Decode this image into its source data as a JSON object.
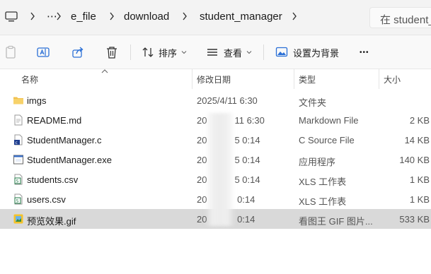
{
  "address_bar": {
    "crumbs": [
      "e_file",
      "download",
      "student_manager"
    ],
    "overflow_glyph": "⋯",
    "search_placeholder": "在 student_m"
  },
  "toolbar": {
    "sort_label": "排序",
    "view_label": "查看",
    "set_background_label": "设置为背景",
    "more_label": "•••"
  },
  "columns": {
    "name": "名称",
    "date": "修改日期",
    "type": "类型",
    "size": "大小"
  },
  "files": [
    {
      "icon": "folder-icon",
      "name": "imgs",
      "date": "2025/4/11 6:30",
      "type": "文件夹",
      "size": "",
      "selected": false
    },
    {
      "icon": "text-file-icon",
      "name": "README.md",
      "date": "20   11 6:30",
      "type": "Markdown File",
      "size": "2 KB",
      "selected": false
    },
    {
      "icon": "c-source-icon",
      "name": "StudentManager.c",
      "date": "20   5 0:14",
      "type": "C Source File",
      "size": "14 KB",
      "selected": false
    },
    {
      "icon": "exe-icon",
      "name": "StudentManager.exe",
      "date": "20   5 0:14",
      "type": "应用程序",
      "size": "140 KB",
      "selected": false
    },
    {
      "icon": "csv-icon",
      "name": "students.csv",
      "date": "20   5 0:14",
      "type": "XLS 工作表",
      "size": "1 KB",
      "selected": false
    },
    {
      "icon": "csv-icon",
      "name": "users.csv",
      "date": "20    0:14",
      "type": "XLS 工作表",
      "size": "1 KB",
      "selected": false
    },
    {
      "icon": "gif-icon",
      "name": "预览效果.gif",
      "date": "20    0:14",
      "type": "看图王 GIF 图片...",
      "size": "533 KB",
      "selected": true
    }
  ],
  "colors": {
    "selected_row": "#d9d9d9",
    "folder": "#f2c14e",
    "accent": "#2a6fd6"
  }
}
